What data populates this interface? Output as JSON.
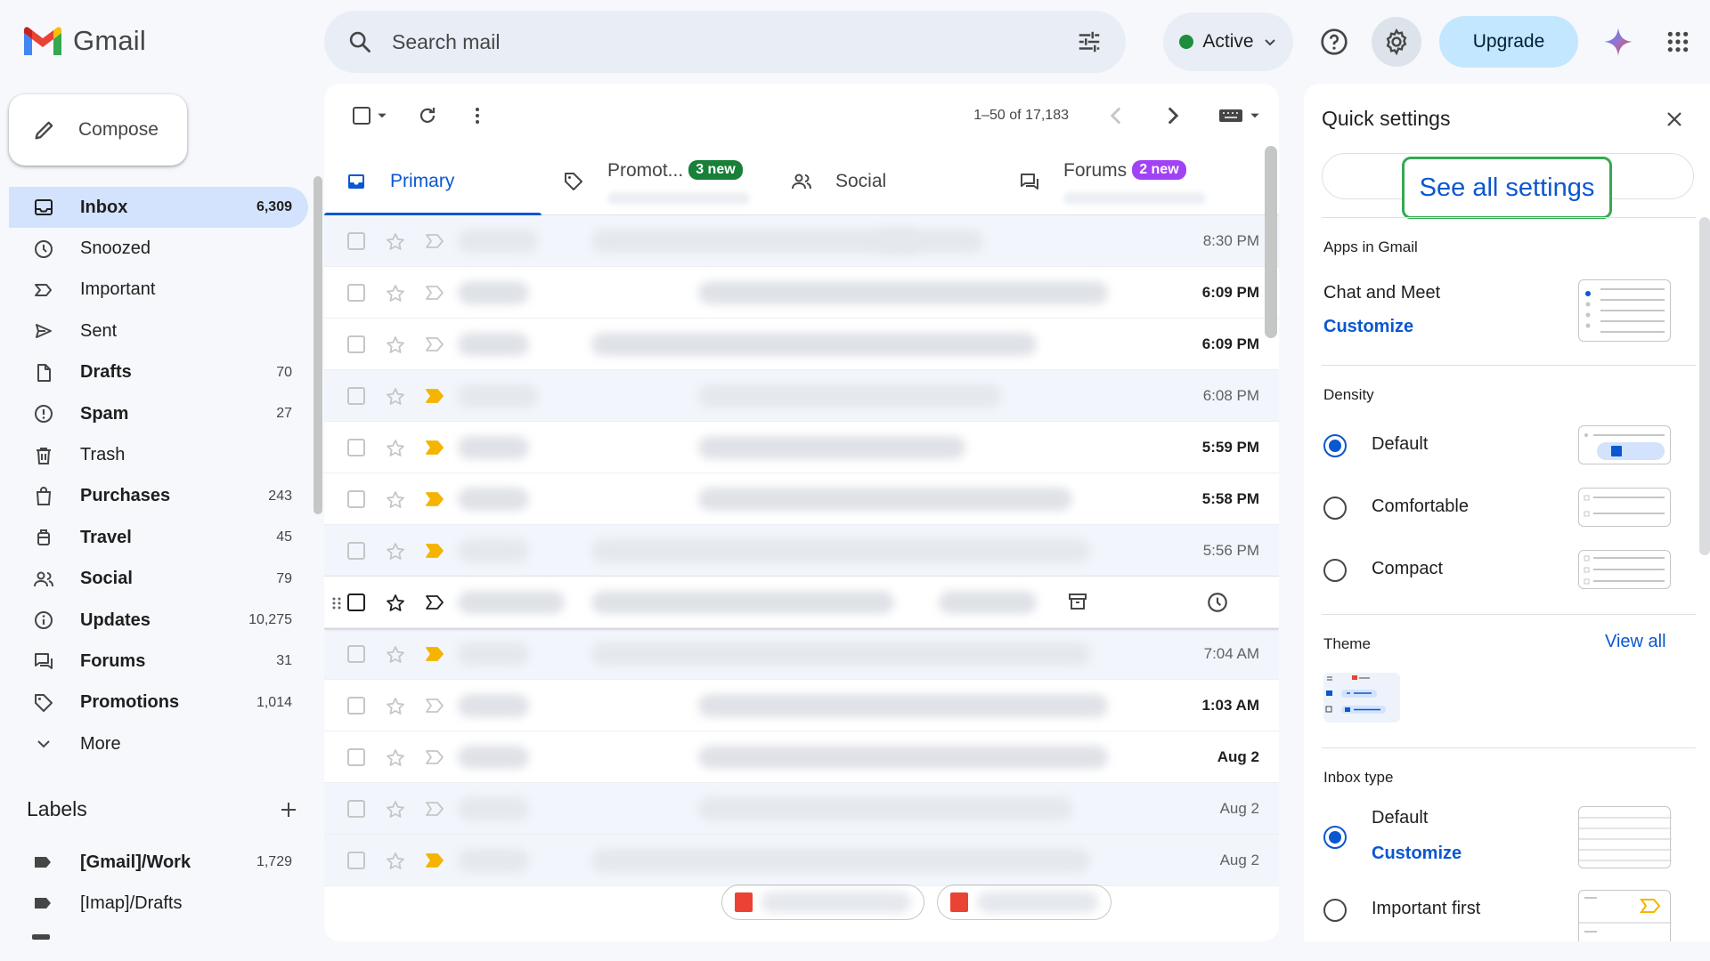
{
  "app": {
    "name": "Gmail"
  },
  "search": {
    "placeholder": "Search mail"
  },
  "header": {
    "status": "Active",
    "upgrade_label": "Upgrade"
  },
  "compose": {
    "label": "Compose"
  },
  "sidebar": {
    "items": [
      {
        "label": "Inbox",
        "count": "6,309",
        "icon": "inbox-icon",
        "selected": true,
        "bold": true
      },
      {
        "label": "Snoozed",
        "count": "",
        "icon": "clock-icon",
        "bold": false
      },
      {
        "label": "Important",
        "count": "",
        "icon": "important-icon",
        "bold": false
      },
      {
        "label": "Sent",
        "count": "",
        "icon": "send-icon",
        "bold": false
      },
      {
        "label": "Drafts",
        "count": "70",
        "icon": "draft-icon",
        "bold": true
      },
      {
        "label": "Spam",
        "count": "27",
        "icon": "spam-icon",
        "bold": true
      },
      {
        "label": "Trash",
        "count": "",
        "icon": "trash-icon",
        "bold": false
      },
      {
        "label": "Purchases",
        "count": "243",
        "icon": "purchases-icon",
        "bold": true
      },
      {
        "label": "Travel",
        "count": "45",
        "icon": "travel-icon",
        "bold": true
      },
      {
        "label": "Social",
        "count": "79",
        "icon": "social-icon",
        "bold": true
      },
      {
        "label": "Updates",
        "count": "10,275",
        "icon": "info-icon",
        "bold": true
      },
      {
        "label": "Forums",
        "count": "31",
        "icon": "forums-icon",
        "bold": true
      },
      {
        "label": "Promotions",
        "count": "1,014",
        "icon": "tag-icon",
        "bold": true
      },
      {
        "label": "More",
        "count": "",
        "icon": "chevron-down-icon",
        "bold": false
      }
    ],
    "labels_title": "Labels",
    "labels": [
      {
        "label": "[Gmail]/Work",
        "count": "1,729",
        "bold": true
      },
      {
        "label": "[Imap]/Drafts",
        "count": "",
        "bold": false
      }
    ]
  },
  "toolbar": {
    "pagination": "1–50 of 17,183"
  },
  "tabs": [
    {
      "label": "Primary",
      "badge": "",
      "selected": true
    },
    {
      "label": "Promot...",
      "badge": "3 new",
      "badge_color": "#188038"
    },
    {
      "label": "Social",
      "badge": ""
    },
    {
      "label": "Forums",
      "badge": "2 new",
      "badge_color": "#a142f4"
    }
  ],
  "emails": [
    {
      "time": "8:30 PM",
      "read": true,
      "important": false
    },
    {
      "time": "6:09 PM",
      "read": false,
      "important": false
    },
    {
      "time": "6:09 PM",
      "read": false,
      "important": false
    },
    {
      "time": "6:08 PM",
      "read": true,
      "important": true
    },
    {
      "time": "5:59 PM",
      "read": false,
      "important": true
    },
    {
      "time": "5:58 PM",
      "read": false,
      "important": true
    },
    {
      "time": "5:56 PM",
      "read": true,
      "important": true
    },
    {
      "time": "",
      "read": false,
      "important": false,
      "hover": true
    },
    {
      "time": "7:04 AM",
      "read": true,
      "important": true
    },
    {
      "time": "1:03 AM",
      "read": false,
      "important": false
    },
    {
      "time": "Aug 2",
      "read": false,
      "important": false
    },
    {
      "time": "Aug 2",
      "read": true,
      "important": false
    },
    {
      "time": "Aug 2",
      "read": true,
      "important": true
    }
  ],
  "quick_settings": {
    "title": "Quick settings",
    "see_all": "See all settings",
    "apps_title": "Apps in Gmail",
    "chat_meet": "Chat and Meet",
    "customize": "Customize",
    "density_title": "Density",
    "density_options": [
      "Default",
      "Comfortable",
      "Compact"
    ],
    "density_selected": "Default",
    "theme_title": "Theme",
    "view_all": "View all",
    "inbox_type_title": "Inbox type",
    "inbox_default": "Default",
    "inbox_customize": "Customize",
    "important_first": "Important first"
  },
  "colors": {
    "accent": "#0b57d0",
    "selected_nav": "#d3e3fd",
    "important": "#f4b400",
    "highlight": "#34a853"
  }
}
